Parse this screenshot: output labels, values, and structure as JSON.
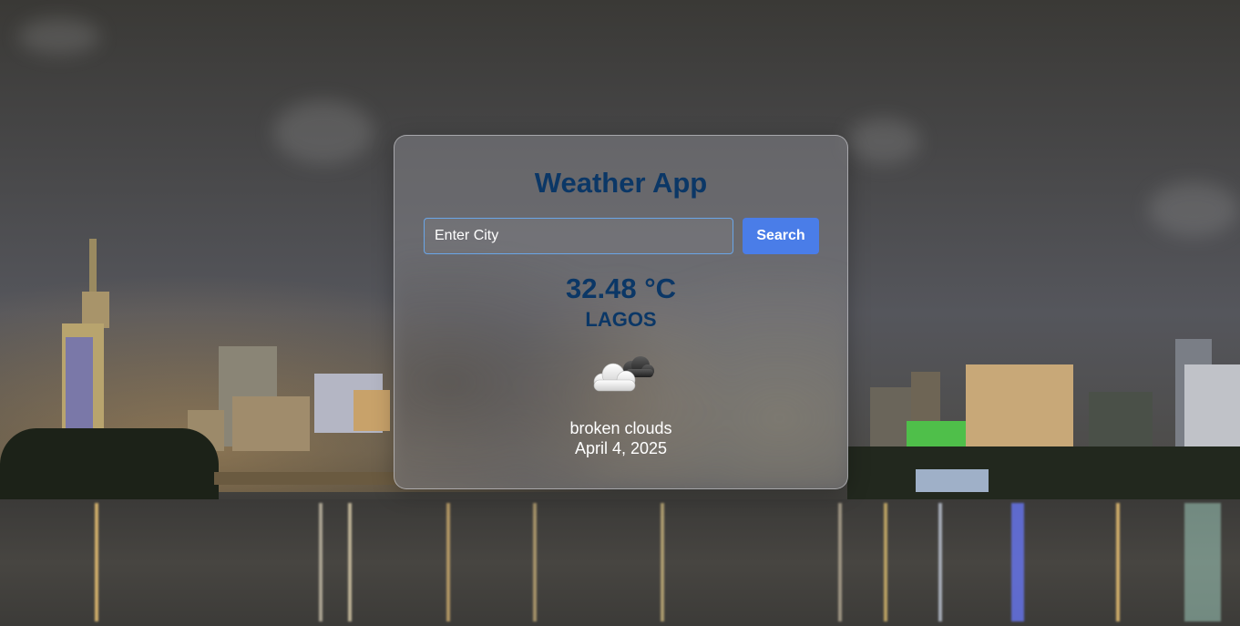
{
  "app": {
    "title": "Weather App"
  },
  "search": {
    "placeholder": "Enter City",
    "value": "",
    "button_label": "Search"
  },
  "weather": {
    "temperature": "32.48 °C",
    "city": "LAGOS",
    "icon": "broken-clouds-icon",
    "description": "broken clouds",
    "date": "April 4, 2025"
  },
  "colors": {
    "title_text": "#0b3766",
    "button_bg": "#4a7de8",
    "input_border": "#6aa6e8"
  }
}
